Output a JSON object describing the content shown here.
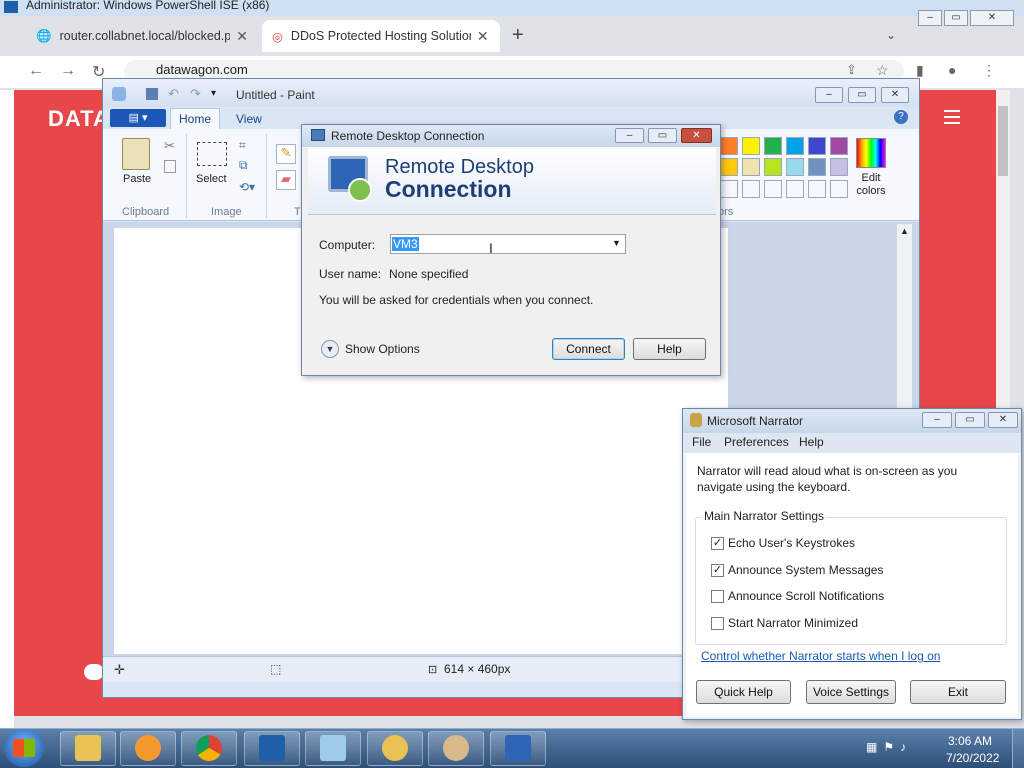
{
  "browser": {
    "titlebar_text": "Administrator: Windows PowerShell ISE (x86)",
    "tabs": [
      {
        "label": "router.collabnet.local/blocked.php",
        "close": "✕"
      },
      {
        "label": "DDoS Protected Hosting Solutions",
        "close": "✕"
      }
    ],
    "new_tab": "+",
    "url": "datawagon.com",
    "page_brand": "DATA",
    "colors": {
      "page_bg": "#e8474a"
    }
  },
  "paint": {
    "title": "Untitled - Paint",
    "menu_button": "▤ ▾",
    "tabs": [
      "Home",
      "View"
    ],
    "help": "?",
    "groups": {
      "clipboard": "Clipboard",
      "image": "Image",
      "tools_partial": "T",
      "colors_partial": "ors"
    },
    "paste_label": "Paste",
    "select_label": "Select",
    "edit_colors_label": "Edit colors",
    "status": {
      "canvas_size": "614 × 460px"
    },
    "palette_row1": [
      "#ff7f27",
      "#fff200",
      "#22b14c",
      "#00a2e8",
      "#3f48cc",
      "#a349a4"
    ],
    "palette_row2": [
      "#ffc90e",
      "#efe4b0",
      "#b5e61d",
      "#99d9ea",
      "#7092be",
      "#c8bfe7"
    ]
  },
  "rdc": {
    "title": "Remote Desktop Connection",
    "banner_line1": "Remote Desktop",
    "banner_line2": "Connection",
    "computer_label": "Computer:",
    "computer_value": "VM3",
    "username_label": "User name:",
    "username_value": "None specified",
    "message": "You will be asked for credentials when you connect.",
    "show_options": "Show Options",
    "connect_button": "Connect",
    "help_button": "Help"
  },
  "narrator": {
    "title": "Microsoft Narrator",
    "menu": [
      "File",
      "Preferences",
      "Help"
    ],
    "intro": "Narrator will read aloud what is on-screen as you navigate using the keyboard.",
    "group_title": "Main Narrator Settings",
    "options": [
      {
        "label": "Echo User's Keystrokes",
        "checked": true
      },
      {
        "label": "Announce System Messages",
        "checked": true
      },
      {
        "label": "Announce Scroll Notifications",
        "checked": false
      },
      {
        "label": "Start Narrator Minimized",
        "checked": false
      }
    ],
    "link": "Control whether Narrator starts when I log on",
    "buttons": {
      "quick_help": "Quick Help",
      "voice_settings": "Voice Settings",
      "exit": "Exit"
    }
  },
  "taskbar": {
    "time": "3:06 AM",
    "date": "7/20/2022",
    "pinned": [
      "explorer-icon",
      "media-player-icon",
      "chrome-icon",
      "powershell-icon",
      "notepad-icon",
      "narrator-icon",
      "paint-icon",
      "remote-desktop-icon"
    ]
  }
}
